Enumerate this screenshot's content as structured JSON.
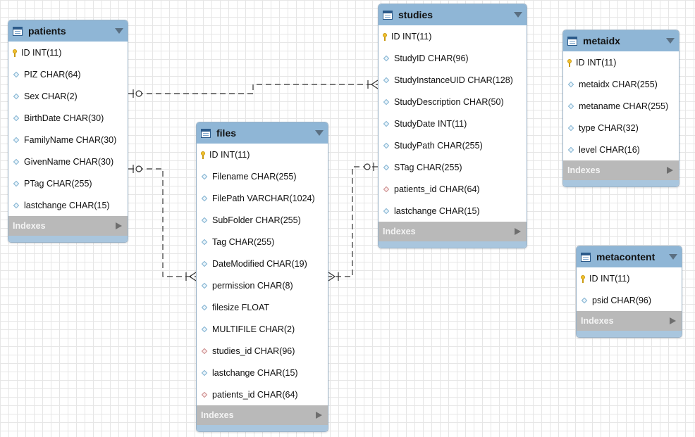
{
  "indexes_label": "Indexes",
  "tables": {
    "patients": {
      "name": "patients",
      "columns": [
        {
          "text": "ID INT(11)",
          "kind": "pk"
        },
        {
          "text": "PIZ CHAR(64)",
          "kind": "attr"
        },
        {
          "text": "Sex CHAR(2)",
          "kind": "attr"
        },
        {
          "text": "BirthDate CHAR(30)",
          "kind": "attr"
        },
        {
          "text": "FamilyName CHAR(30)",
          "kind": "attr"
        },
        {
          "text": "GivenName CHAR(30)",
          "kind": "attr"
        },
        {
          "text": "PTag CHAR(255)",
          "kind": "attr"
        },
        {
          "text": "lastchange CHAR(15)",
          "kind": "attr"
        }
      ]
    },
    "files": {
      "name": "files",
      "columns": [
        {
          "text": "ID INT(11)",
          "kind": "pk"
        },
        {
          "text": "Filename CHAR(255)",
          "kind": "attr"
        },
        {
          "text": "FilePath VARCHAR(1024)",
          "kind": "attr"
        },
        {
          "text": "SubFolder CHAR(255)",
          "kind": "attr"
        },
        {
          "text": "Tag CHAR(255)",
          "kind": "attr"
        },
        {
          "text": "DateModified CHAR(19)",
          "kind": "attr"
        },
        {
          "text": "permission CHAR(8)",
          "kind": "attr"
        },
        {
          "text": "filesize FLOAT",
          "kind": "attr"
        },
        {
          "text": "MULTIFILE CHAR(2)",
          "kind": "attr"
        },
        {
          "text": "studies_id CHAR(96)",
          "kind": "fk"
        },
        {
          "text": "lastchange CHAR(15)",
          "kind": "attr"
        },
        {
          "text": "patients_id CHAR(64)",
          "kind": "fk"
        }
      ]
    },
    "studies": {
      "name": "studies",
      "columns": [
        {
          "text": "ID INT(11)",
          "kind": "pk"
        },
        {
          "text": "StudyID CHAR(96)",
          "kind": "attr"
        },
        {
          "text": "StudyInstanceUID CHAR(128)",
          "kind": "attr"
        },
        {
          "text": "StudyDescription CHAR(50)",
          "kind": "attr"
        },
        {
          "text": "StudyDate INT(11)",
          "kind": "attr"
        },
        {
          "text": "StudyPath CHAR(255)",
          "kind": "attr"
        },
        {
          "text": "STag CHAR(255)",
          "kind": "attr"
        },
        {
          "text": "patients_id CHAR(64)",
          "kind": "fk"
        },
        {
          "text": "lastchange CHAR(15)",
          "kind": "attr"
        }
      ]
    },
    "metaidx": {
      "name": "metaidx",
      "columns": [
        {
          "text": "ID INT(11)",
          "kind": "pk"
        },
        {
          "text": "metaidx CHAR(255)",
          "kind": "attr"
        },
        {
          "text": "metaname CHAR(255)",
          "kind": "attr"
        },
        {
          "text": "type CHAR(32)",
          "kind": "attr"
        },
        {
          "text": "level CHAR(16)",
          "kind": "attr"
        }
      ]
    },
    "metacontent": {
      "name": "metacontent",
      "columns": [
        {
          "text": "ID INT(11)",
          "kind": "pk"
        },
        {
          "text": "psid CHAR(96)",
          "kind": "attr"
        }
      ]
    }
  },
  "relationships": [
    {
      "from": "patients",
      "to": "studies",
      "from_end": "zero-or-one",
      "to_end": "one-or-many"
    },
    {
      "from": "patients",
      "to": "files",
      "from_end": "zero-or-one",
      "to_end": "one-or-many"
    },
    {
      "from": "studies",
      "to": "files",
      "from_end": "zero-or-one",
      "to_end": "one-or-many"
    }
  ],
  "colors": {
    "header": "#8fb6d6",
    "indexes_bar": "#b9b9b9",
    "footer": "#a9c6de",
    "line": "#333333",
    "pk_key": "#f2c12e",
    "fk_marker": "#c98a8a"
  }
}
